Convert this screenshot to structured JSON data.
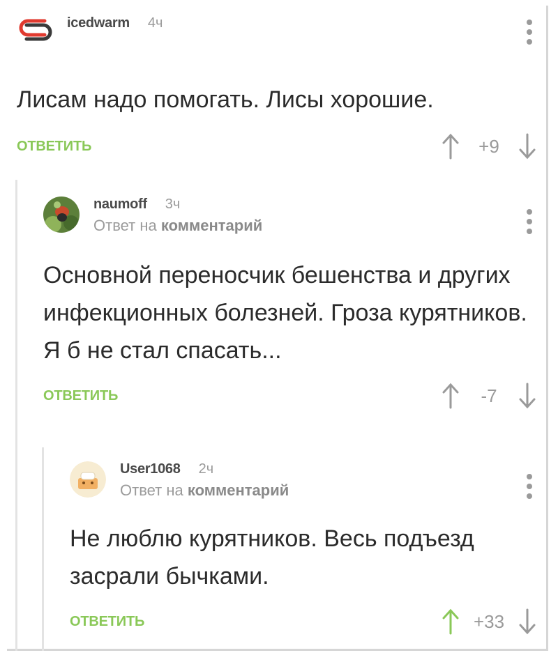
{
  "comments": [
    {
      "username": "icedwarm",
      "time": "4ч",
      "text": "Лисам надо помогать. Лисы хорошие.",
      "reply_label": "ОТВЕТИТЬ",
      "score": "+9",
      "upvoted": false
    },
    {
      "username": "naumoff",
      "time": "3ч",
      "reply_prefix": "Ответ на",
      "reply_target": "комментарий",
      "text": "Основной переносчик бешенства и других инфекционных болезней. Гроза курятников. Я б не стал спасать...",
      "reply_label": "ОТВЕТИТЬ",
      "score": "-7",
      "upvoted": false
    },
    {
      "username": "User1068",
      "time": "2ч",
      "reply_prefix": "Ответ на",
      "reply_target": "комментарий",
      "text": "Не люблю курятников. Весь подъезд засрали бычками.",
      "reply_label": "ОТВЕТИТЬ",
      "score": "+33",
      "upvoted": true
    }
  ],
  "colors": {
    "accent_green": "#8ac858",
    "logo_red": "#e03a2f",
    "text": "#2b2b2b",
    "muted": "#9a9a9a"
  },
  "icons": [
    "site-logo-icon",
    "avatar-naumoff",
    "avatar-user1068",
    "more-vert-icon",
    "arrow-up-icon",
    "arrow-down-icon"
  ]
}
